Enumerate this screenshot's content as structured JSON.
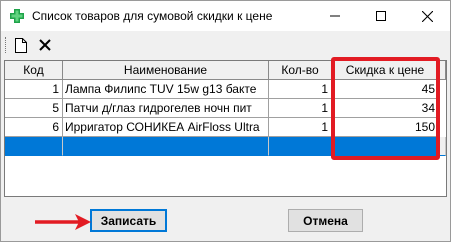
{
  "window": {
    "title": "Список товаров для сумовой скидки к цене",
    "controls": [
      "minimize-icon",
      "maximize-icon",
      "close-icon"
    ]
  },
  "toolbar": {
    "buttons": [
      "new-document-icon",
      "delete-x-icon"
    ]
  },
  "grid": {
    "columns": [
      "Код",
      "Наименование",
      "Кол-во",
      "Скидка к цене"
    ],
    "rows": [
      {
        "code": "1",
        "name": "Лампа Филипс TUV 15w g13 бакте",
        "qty": "1",
        "discount": "45"
      },
      {
        "code": "5",
        "name": "Патчи д/глаз гидрогелев ночн пит",
        "qty": "1",
        "discount": "34"
      },
      {
        "code": "6",
        "name": "Ирригатор СОНИКЕА AirFloss Ultra",
        "qty": "1",
        "discount": "150"
      }
    ]
  },
  "buttons": {
    "save_label": "Записать",
    "cancel_label": "Отмена"
  },
  "annotations": {
    "highlight_color": "#e21b23",
    "arrow_color": "#e21b23",
    "selection_color": "#0078d7"
  }
}
